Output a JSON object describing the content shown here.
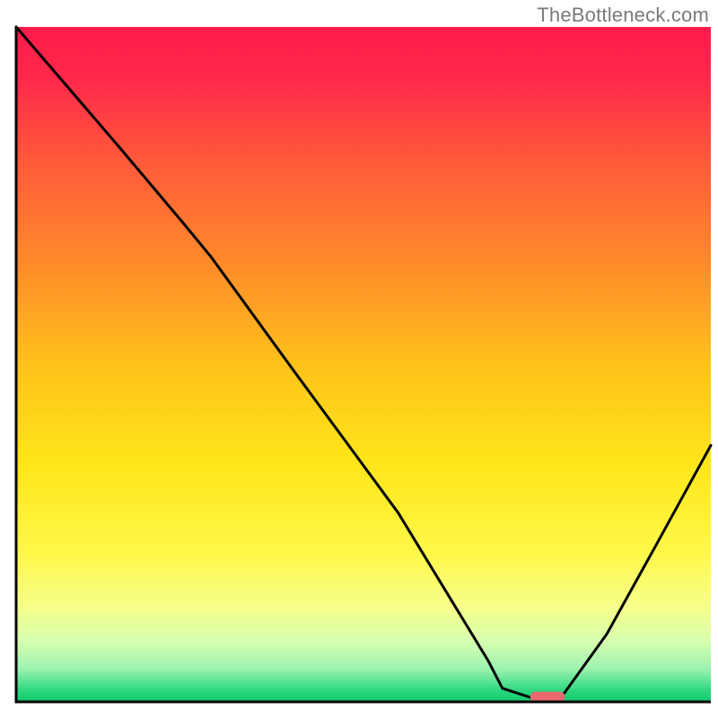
{
  "watermark": "TheBottleneck.com",
  "chart_data": {
    "type": "line",
    "title": "",
    "xlabel": "",
    "ylabel": "",
    "xlim": [
      0,
      100
    ],
    "ylim": [
      0,
      100
    ],
    "background_gradient_stops": [
      {
        "offset": 0.0,
        "color": "#ff1a4b"
      },
      {
        "offset": 0.08,
        "color": "#ff2a4a"
      },
      {
        "offset": 0.2,
        "color": "#ff5a3a"
      },
      {
        "offset": 0.35,
        "color": "#ff8a2a"
      },
      {
        "offset": 0.5,
        "color": "#ffc21a"
      },
      {
        "offset": 0.65,
        "color": "#ffe61a"
      },
      {
        "offset": 0.78,
        "color": "#fff84a"
      },
      {
        "offset": 0.86,
        "color": "#f6ff8a"
      },
      {
        "offset": 0.91,
        "color": "#d7ffb0"
      },
      {
        "offset": 0.95,
        "color": "#9ef3b0"
      },
      {
        "offset": 0.985,
        "color": "#27d77d"
      },
      {
        "offset": 1.0,
        "color": "#15c96e"
      }
    ],
    "series": [
      {
        "name": "bottleneck-curve",
        "x": [
          0.0,
          5.0,
          15.0,
          24.0,
          28.0,
          40.0,
          55.0,
          68.0,
          70.0,
          76.0,
          78.0,
          85.0,
          92.0,
          100.0
        ],
        "values": [
          100.0,
          94.0,
          82.0,
          71.0,
          66.0,
          49.0,
          28.0,
          6.0,
          2.0,
          0.0,
          0.0,
          10.0,
          23.0,
          38.0
        ]
      }
    ],
    "marker": {
      "name": "selected-point",
      "x": 76.5,
      "y": 0,
      "width": 5,
      "height": 1.5,
      "color": "#e86a6e"
    },
    "axes_color": "#000000",
    "axes_width": 3
  }
}
